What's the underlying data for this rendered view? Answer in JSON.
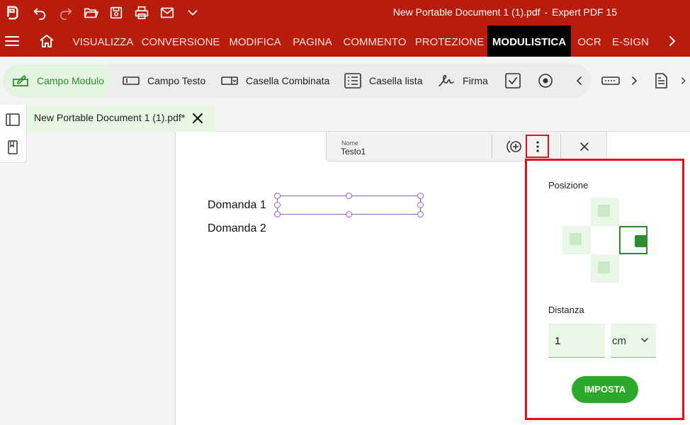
{
  "window": {
    "title": "New Portable Document 1 (1).pdf",
    "app_name": "Expert PDF 15",
    "separator": "-"
  },
  "menu": {
    "items": [
      "VISUALIZZA",
      "CONVERSIONE",
      "MODIFICA",
      "PAGINA",
      "COMMENTO",
      "PROTEZIONE",
      "MODULISTICA",
      "OCR",
      "E-SIGN"
    ],
    "active": "MODULISTICA"
  },
  "ribbon": {
    "campo_modulo": "Campo Modulo",
    "campo_testo": "Campo Testo",
    "casella_combinata": "Casella Combinata",
    "casella_lista": "Casella lista",
    "firma": "Firma"
  },
  "document_tab": {
    "label": "New Portable Document 1 (1).pdf*"
  },
  "document": {
    "question1": "Domanda 1",
    "question2": "Domanda 2"
  },
  "field_toolbar": {
    "name_label": "Nome",
    "name_value": "Testo1"
  },
  "position_popup": {
    "title": "Posizione",
    "selected_position": "right",
    "distance_label": "Distanza",
    "distance_value": "1",
    "unit": "cm",
    "apply_label": "IMPOSTA"
  },
  "colors": {
    "brand_red": "#b71c0c",
    "accent_green": "#2aa92a",
    "highlight_red": "#e0101a",
    "field_purple": "#9b59c4"
  }
}
